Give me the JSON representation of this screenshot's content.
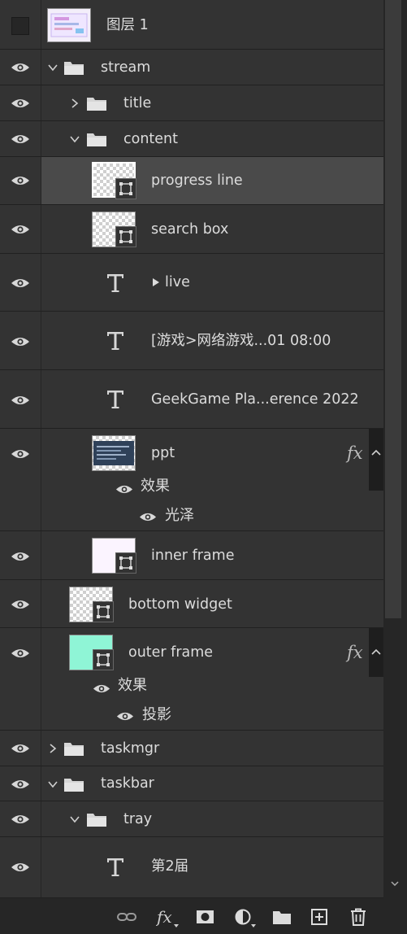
{
  "layers": {
    "top": "图层 1",
    "stream": "stream",
    "title": "title",
    "content": "content",
    "progress_line": "progress line",
    "search_box": "search box",
    "live": "live",
    "game_text": "[游戏>网络游戏...01 08:00",
    "geekgame": "GeekGame Pla...erence 2022",
    "ppt": "ppt",
    "ppt_effects": "效果",
    "ppt_gloss": "光泽",
    "inner_frame": "inner frame",
    "bottom_widget": "bottom widget",
    "outer_frame": "outer frame",
    "outer_effects": "效果",
    "outer_shadow": "投影",
    "taskmgr": "taskmgr",
    "taskbar": "taskbar",
    "tray": "tray",
    "second": "第2届"
  },
  "fx_label": "fx",
  "toolbar_icons": [
    "link-icon",
    "fx-icon",
    "mask-icon",
    "adjustment-icon",
    "new-group-icon",
    "new-layer-icon",
    "trash-icon"
  ],
  "colors": {
    "panel_bg": "#262626",
    "row_bg": "#333333",
    "selected_row": "#4a4a4a",
    "text": "#dcdcdc",
    "outer_frame_thumb": "#8ff5d6",
    "inner_frame_thumb": "#fbf4ff"
  }
}
